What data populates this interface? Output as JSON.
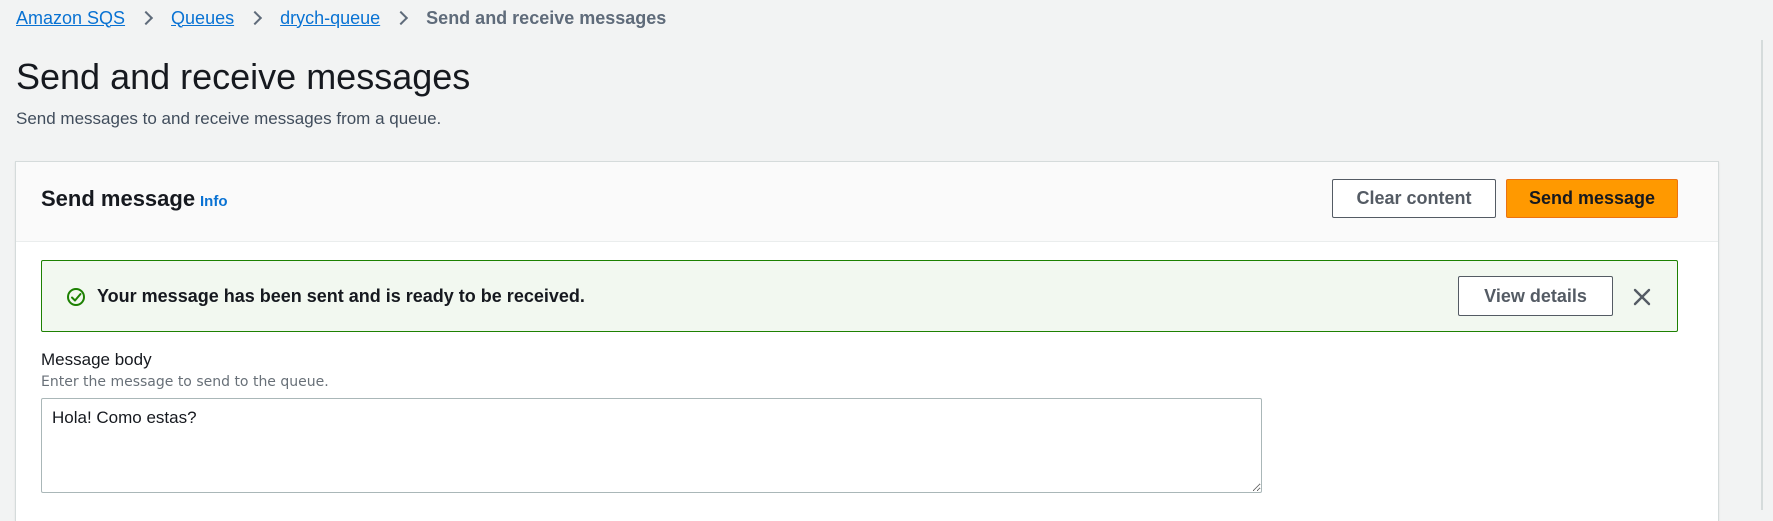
{
  "breadcrumb": {
    "items": [
      {
        "label": "Amazon SQS"
      },
      {
        "label": "Queues"
      },
      {
        "label": "drych-queue"
      }
    ],
    "current": "Send and receive messages"
  },
  "header": {
    "title": "Send and receive messages",
    "description": "Send messages to and receive messages from a queue."
  },
  "send_panel": {
    "title": "Send message",
    "info_link": "Info",
    "clear_label": "Clear content",
    "send_label": "Send message"
  },
  "alert": {
    "type": "success",
    "message": "Your message has been sent and is ready to be received.",
    "view_details_label": "View details",
    "icon": "check-circle-icon",
    "dismiss_icon": "close-icon"
  },
  "message_body": {
    "label": "Message body",
    "description": "Enter the message to send to the queue.",
    "value": "Hola! Como estas?"
  },
  "colors": {
    "link": "#0972d3",
    "primary_button": "#ff9900",
    "success_border": "#1d8102",
    "success_bg": "#f2f8f0"
  }
}
